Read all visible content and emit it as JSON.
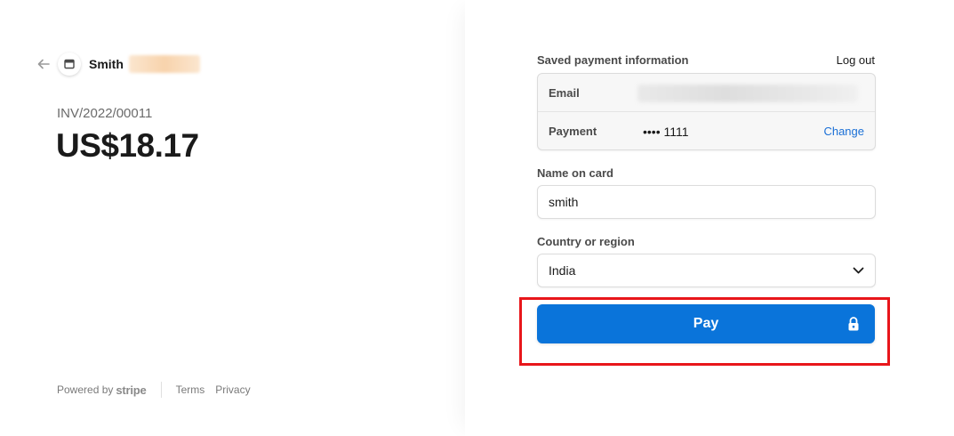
{
  "merchant": {
    "name": "Smith",
    "back_icon": "arrow-left-icon",
    "logo_icon": "store-icon"
  },
  "invoice": {
    "number": "INV/2022/00011",
    "amount": "US$18.17"
  },
  "footer": {
    "powered_by": "Powered by",
    "brand": "stripe",
    "terms": "Terms",
    "privacy": "Privacy"
  },
  "saved_payment": {
    "title": "Saved payment information",
    "logout": "Log out",
    "email_label": "Email",
    "payment_label": "Payment",
    "card_masked": "•••• 1111",
    "change": "Change"
  },
  "form": {
    "name_label": "Name on card",
    "name_value": "smith",
    "country_label": "Country or region",
    "country_value": "India",
    "pay_label": "Pay"
  },
  "colors": {
    "accent": "#0a74da",
    "link": "#1a6fd6",
    "highlight": "#e8161b"
  }
}
